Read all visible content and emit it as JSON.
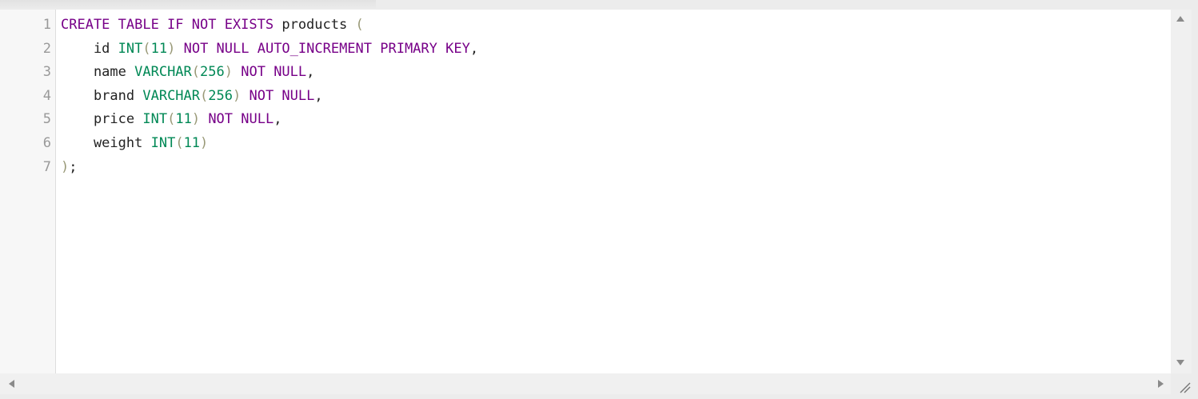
{
  "editor": {
    "line_numbers": [
      "1",
      "2",
      "3",
      "4",
      "5",
      "6",
      "7"
    ],
    "lines": [
      [
        {
          "t": "CREATE TABLE IF NOT EXISTS",
          "c": "kw"
        },
        {
          "t": " products ",
          "c": ""
        },
        {
          "t": "(",
          "c": "br"
        }
      ],
      [
        {
          "t": "    id ",
          "c": ""
        },
        {
          "t": "INT",
          "c": "ty"
        },
        {
          "t": "(",
          "c": "br"
        },
        {
          "t": "11",
          "c": "ty"
        },
        {
          "t": ")",
          "c": "br"
        },
        {
          "t": " ",
          "c": ""
        },
        {
          "t": "NOT NULL AUTO_INCREMENT PRIMARY KEY",
          "c": "kw"
        },
        {
          "t": ",",
          "c": ""
        }
      ],
      [
        {
          "t": "    name ",
          "c": ""
        },
        {
          "t": "VARCHAR",
          "c": "ty"
        },
        {
          "t": "(",
          "c": "br"
        },
        {
          "t": "256",
          "c": "ty"
        },
        {
          "t": ")",
          "c": "br"
        },
        {
          "t": " ",
          "c": ""
        },
        {
          "t": "NOT NULL",
          "c": "kw"
        },
        {
          "t": ",",
          "c": ""
        }
      ],
      [
        {
          "t": "    brand ",
          "c": ""
        },
        {
          "t": "VARCHAR",
          "c": "ty"
        },
        {
          "t": "(",
          "c": "br"
        },
        {
          "t": "256",
          "c": "ty"
        },
        {
          "t": ")",
          "c": "br"
        },
        {
          "t": " ",
          "c": ""
        },
        {
          "t": "NOT NULL",
          "c": "kw"
        },
        {
          "t": ",",
          "c": ""
        }
      ],
      [
        {
          "t": "    price ",
          "c": ""
        },
        {
          "t": "INT",
          "c": "ty"
        },
        {
          "t": "(",
          "c": "br"
        },
        {
          "t": "11",
          "c": "ty"
        },
        {
          "t": ")",
          "c": "br"
        },
        {
          "t": " ",
          "c": ""
        },
        {
          "t": "NOT NULL",
          "c": "kw"
        },
        {
          "t": ",",
          "c": ""
        }
      ],
      [
        {
          "t": "    weight ",
          "c": ""
        },
        {
          "t": "INT",
          "c": "ty"
        },
        {
          "t": "(",
          "c": "br"
        },
        {
          "t": "11",
          "c": "ty"
        },
        {
          "t": ")",
          "c": "br"
        }
      ],
      [
        {
          "t": ")",
          "c": "br"
        },
        {
          "t": ";",
          "c": ""
        }
      ]
    ],
    "colors": {
      "keyword": "#770088",
      "type": "#008855",
      "bracket": "#999977",
      "text": "#222222",
      "line_number": "#999999"
    },
    "icons": {
      "scroll_up": "arrow-up-icon",
      "scroll_down": "arrow-down-icon",
      "scroll_left": "arrow-left-icon",
      "scroll_right": "arrow-right-icon",
      "resize": "resize-grip-icon"
    }
  }
}
